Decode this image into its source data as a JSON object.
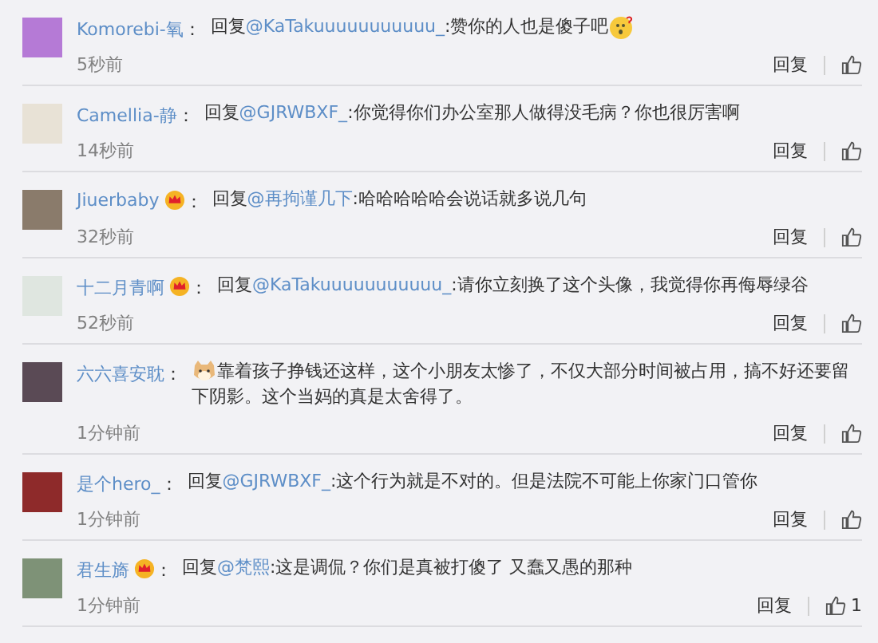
{
  "comments": [
    {
      "name": "Komorebi-氧",
      "vip": false,
      "colon": "：",
      "reply_prefix": "回复",
      "mention": "@KaTakuuuuuuuuuuu_",
      "body": ":赞你的人也是傻子吧",
      "leading_emoji": false,
      "trailing_emoji": true,
      "time": "5秒前",
      "reply_label": "回复"
    },
    {
      "name": "Camellia-静",
      "vip": false,
      "colon": "：",
      "reply_prefix": "回复",
      "mention": "@GJRWBXF_",
      "body": ":你觉得你们办公室那人做得没毛病？你也很厉害啊",
      "leading_emoji": false,
      "trailing_emoji": false,
      "time": "14秒前",
      "reply_label": "回复"
    },
    {
      "name": "Jiuerbaby",
      "vip": true,
      "colon": "：",
      "reply_prefix": "回复",
      "mention": "@再拘谨几下",
      "body": ":哈哈哈哈哈会说话就多说几句",
      "leading_emoji": false,
      "trailing_emoji": false,
      "time": "32秒前",
      "reply_label": "回复"
    },
    {
      "name": "十二月青啊",
      "vip": true,
      "colon": "：",
      "reply_prefix": "回复",
      "mention": "@KaTakuuuuuuuuuuu_",
      "body": ":请你立刻换了这个头像，我觉得你再侮辱绿谷",
      "leading_emoji": false,
      "trailing_emoji": false,
      "time": "52秒前",
      "reply_label": "回复"
    },
    {
      "name": "六六喜安耽",
      "vip": false,
      "colon": "：",
      "leading_emoji": true,
      "trailing_emoji": false,
      "body": "靠着孩子挣钱还这样，这个小朋友太惨了，不仅大部分时间被占用，搞不好还要留下阴影。这个当妈的真是太舍得了。",
      "time": "1分钟前",
      "reply_label": "回复"
    },
    {
      "name": "是个hero_",
      "vip": false,
      "colon": "：",
      "reply_prefix": "回复",
      "mention": "@GJRWBXF_",
      "body": ":这个行为就是不对的。但是法院不可能上你家门口管你",
      "leading_emoji": false,
      "trailing_emoji": false,
      "time": "1分钟前",
      "reply_label": "回复"
    },
    {
      "name": "君生旖",
      "vip": true,
      "colon": "：",
      "reply_prefix": "回复",
      "mention": "@梵熙",
      "body": ":这是调侃？你们是真被打傻了 又蠢又愚的那种",
      "leading_emoji": false,
      "trailing_emoji": false,
      "time": "1分钟前",
      "reply_label": "回复",
      "likes": "1"
    }
  ]
}
